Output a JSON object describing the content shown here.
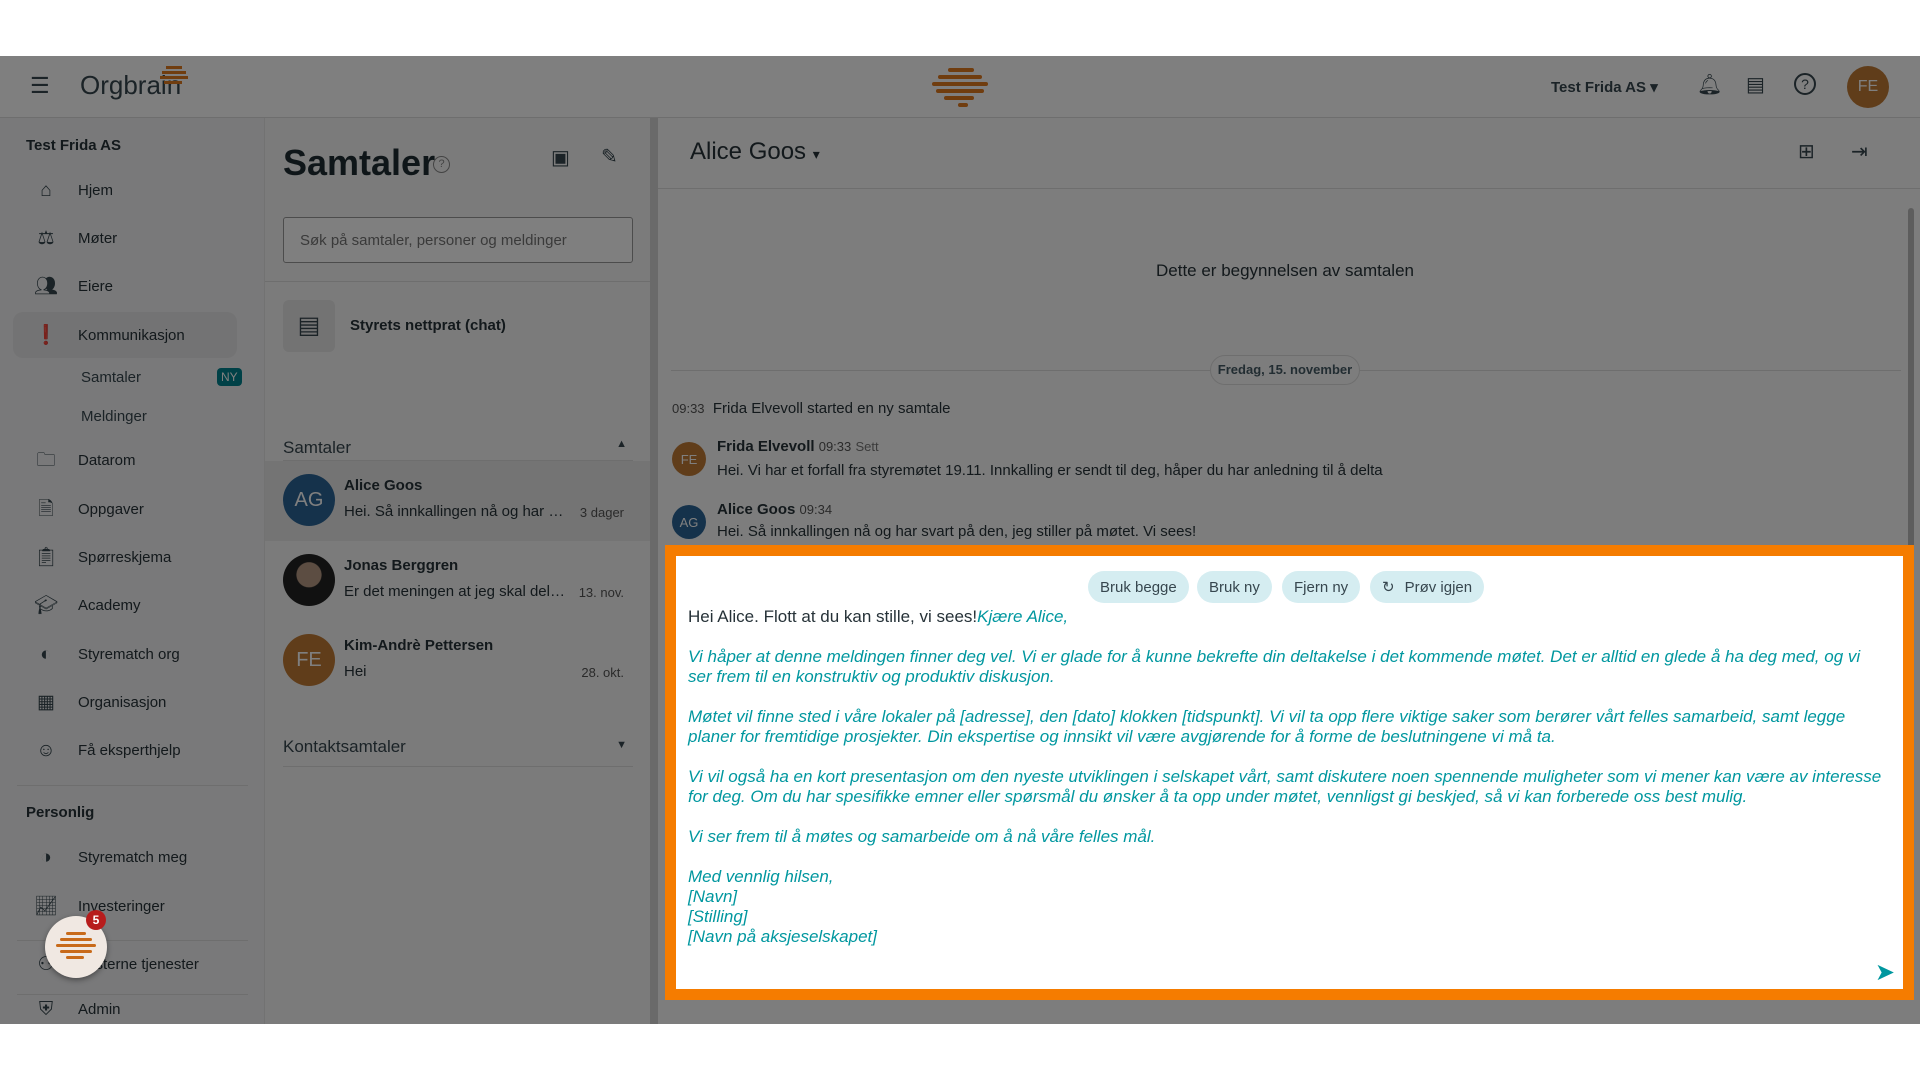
{
  "header": {
    "logo_text": "Orgbrain",
    "org_selector": "Test Frida AS",
    "user_initials": "FE",
    "icons": [
      "menu-icon",
      "bell-icon",
      "chat-icon",
      "help-icon"
    ]
  },
  "sidebar": {
    "org_title": "Test Frida AS",
    "items": [
      {
        "label": "Hjem",
        "icon": "home-icon"
      },
      {
        "label": "Møter",
        "icon": "gavel-icon"
      },
      {
        "label": "Eiere",
        "icon": "people-icon"
      },
      {
        "label": "Kommunikasjon",
        "icon": "feedback-icon"
      },
      {
        "label": "Datarom",
        "icon": "folder-icon"
      },
      {
        "label": "Oppgaver",
        "icon": "task-icon"
      },
      {
        "label": "Spørreskjema",
        "icon": "survey-icon"
      },
      {
        "label": "Academy",
        "icon": "school-icon"
      },
      {
        "label": "Styrematch org",
        "icon": "match-icon"
      },
      {
        "label": "Organisasjon",
        "icon": "building-icon"
      },
      {
        "label": "Få eksperthjelp",
        "icon": "expert-icon"
      }
    ],
    "sub_items": [
      {
        "label": "Samtaler",
        "badge": "NY"
      },
      {
        "label": "Meldinger"
      }
    ],
    "personal_title": "Personlig",
    "personal_items": [
      {
        "label": "Styrematch meg",
        "icon": "match-icon"
      },
      {
        "label": "Investeringer",
        "icon": "chart-icon"
      },
      {
        "label": "Eksterne tjenester",
        "icon": "services-icon"
      },
      {
        "label": "Admin",
        "icon": "admin-icon"
      }
    ],
    "fab_badge": "5"
  },
  "conversations": {
    "title": "Samtaler",
    "search_placeholder": "Søk på samtaler, personer og meldinger",
    "board_chat": "Styrets nettprat (chat)",
    "section_title": "Samtaler",
    "items": [
      {
        "initials": "AG",
        "name": "Alice Goos",
        "preview": "Hei. Så innkallingen nå og har svart på den",
        "date": "3 dager",
        "color": "#2a6496"
      },
      {
        "initials": "",
        "name": "Jonas Berggren",
        "preview": "Er det meningen at jeg skal delta?",
        "date": "13. nov.",
        "color": "#333333"
      },
      {
        "initials": "FE",
        "name": "Kim-Andrè Pettersen",
        "preview": "Hei",
        "date": "28. okt.",
        "color": "#c07a35"
      }
    ],
    "contacts_title": "Kontaktsamtaler"
  },
  "chat": {
    "title": "Alice Goos",
    "start_text": "Dette er begynnelsen av samtalen",
    "date_divider": "Fredag, 15. november",
    "system": {
      "time": "09:33",
      "text": "Frida Elvevoll started en ny samtale"
    },
    "messages": [
      {
        "initials": "FE",
        "name": "Frida Elvevoll",
        "time": "09:33",
        "status": "Sett",
        "text": "Hei. Vi har et forfall fra styremøtet 19.11. Innkalling er sendt til deg, håper du har anledning til å delta",
        "color": "#c07a35"
      },
      {
        "initials": "AG",
        "name": "Alice Goos",
        "time": "09:34",
        "status": "",
        "text": "Hei. Så innkallingen nå og har svart på den, jeg stiller på møtet. Vi sees!",
        "color": "#2a6496"
      }
    ],
    "composer": {
      "buttons": {
        "use_both": "Bruk begge",
        "use_new": "Bruk ny",
        "remove_new": "Fjern ny",
        "retry": "Prøv igjen"
      },
      "original_text": "Hei Alice. Flott at du kan stille, vi sees!",
      "ai_greeting": "Kjære Alice,",
      "ai_paragraphs": [
        "Vi håper at denne meldingen finner deg vel. Vi er glade for å kunne bekrefte din deltakelse i det kommende møtet. Det er alltid en glede å ha deg med, og vi ser frem til en konstruktiv og produktiv diskusjon.",
        "Møtet vil finne sted i våre lokaler på [adresse], den [dato] klokken [tidspunkt]. Vi vil ta opp flere viktige saker som berører vårt felles samarbeid, samt legge planer for fremtidige prosjekter. Din ekspertise og innsikt vil være avgjørende for å forme de beslutningene vi må ta.",
        "Vi vil også ha en kort presentasjon om den nyeste utviklingen i selskapet vårt, samt diskutere noen spennende muligheter som vi mener kan være av interesse for deg. Om du har spesifikke emner eller spørsmål du ønsker å ta opp under møtet, vennligst gi beskjed, så vi kan forberede oss best mulig.",
        "Vi ser frem til å møtes og samarbeide om å nå våre felles mål."
      ],
      "signature": [
        "Med vennlig hilsen,",
        "[Navn]",
        "[Stilling]",
        "[Navn på aksjeselskapet]"
      ]
    }
  },
  "colors": {
    "accent": "#f57c00",
    "ai_text": "#00979f",
    "chip_bg": "#d5edf1",
    "badge": "#00838f"
  }
}
